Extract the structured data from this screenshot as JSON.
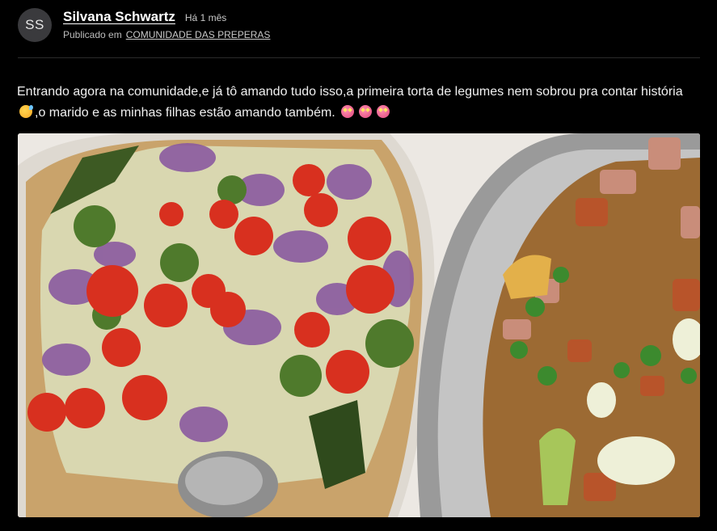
{
  "post": {
    "author": {
      "initials": "SS",
      "name": "Silvana Schwartz"
    },
    "time_ago": "Há 1 mês",
    "published_in_label": "Publicado em",
    "community": "COMUNIDADE DAS PREPERAS",
    "text_part1": "Entrando agora na comunidade,e já tô amando tudo isso,a primeira torta de legumes nem sobrou pra contar história",
    "text_part2": ",o marido e as minhas filhas estão amando também.",
    "emojis": [
      "smiling-face-with-sweat-icon",
      "star-struck-icon",
      "star-struck-icon",
      "star-struck-icon"
    ],
    "photo": {
      "subject": "vegetable-pie-and-rice-dish-photo"
    }
  },
  "colors": {
    "background": "#000000",
    "text": "#f0f0f0",
    "muted": "#bdbdbd",
    "avatar_bg": "#3a3a3d",
    "divider": "#2b2b2b"
  }
}
